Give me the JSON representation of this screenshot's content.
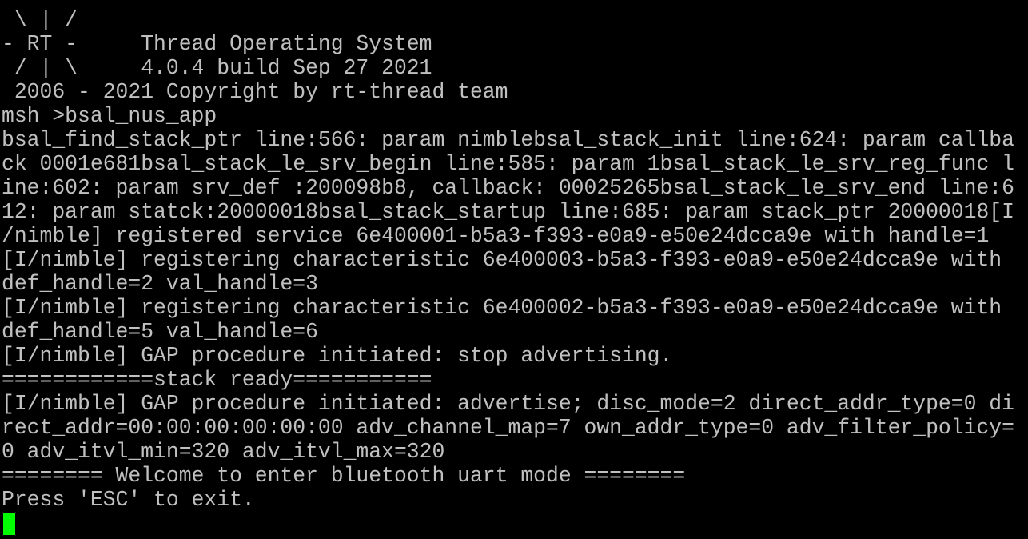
{
  "terminal": {
    "lines": [
      " \\ | /",
      "- RT -     Thread Operating System",
      " / | \\     4.0.4 build Sep 27 2021",
      " 2006 - 2021 Copyright by rt-thread team",
      "msh >bsal_nus_app",
      "bsal_find_stack_ptr line:566: param nimblebsal_stack_init line:624: param callba",
      "ck 0001e681bsal_stack_le_srv_begin line:585: param 1bsal_stack_le_srv_reg_func l",
      "ine:602: param srv_def :200098b8, callback: 00025265bsal_stack_le_srv_end line:6",
      "12: param statck:20000018bsal_stack_startup line:685: param stack_ptr 20000018[I",
      "/nimble] registered service 6e400001-b5a3-f393-e0a9-e50e24dcca9e with handle=1",
      "[I/nimble] registering characteristic 6e400003-b5a3-f393-e0a9-e50e24dcca9e with",
      "def_handle=2 val_handle=3",
      "[I/nimble] registering characteristic 6e400002-b5a3-f393-e0a9-e50e24dcca9e with",
      "def_handle=5 val_handle=6",
      "[I/nimble] GAP procedure initiated: stop advertising.",
      "============stack ready===========",
      "[I/nimble] GAP procedure initiated: advertise; disc_mode=2 direct_addr_type=0 di",
      "rect_addr=00:00:00:00:00:00 adv_channel_map=7 own_addr_type=0 adv_filter_policy=",
      "0 adv_itvl_min=320 adv_itvl_max=320",
      "======== Welcome to enter bluetooth uart mode ========",
      "Press 'ESC' to exit."
    ],
    "colors": {
      "background": "#000000",
      "text": "#c0c0c0",
      "cursor": "#00ff00"
    }
  }
}
